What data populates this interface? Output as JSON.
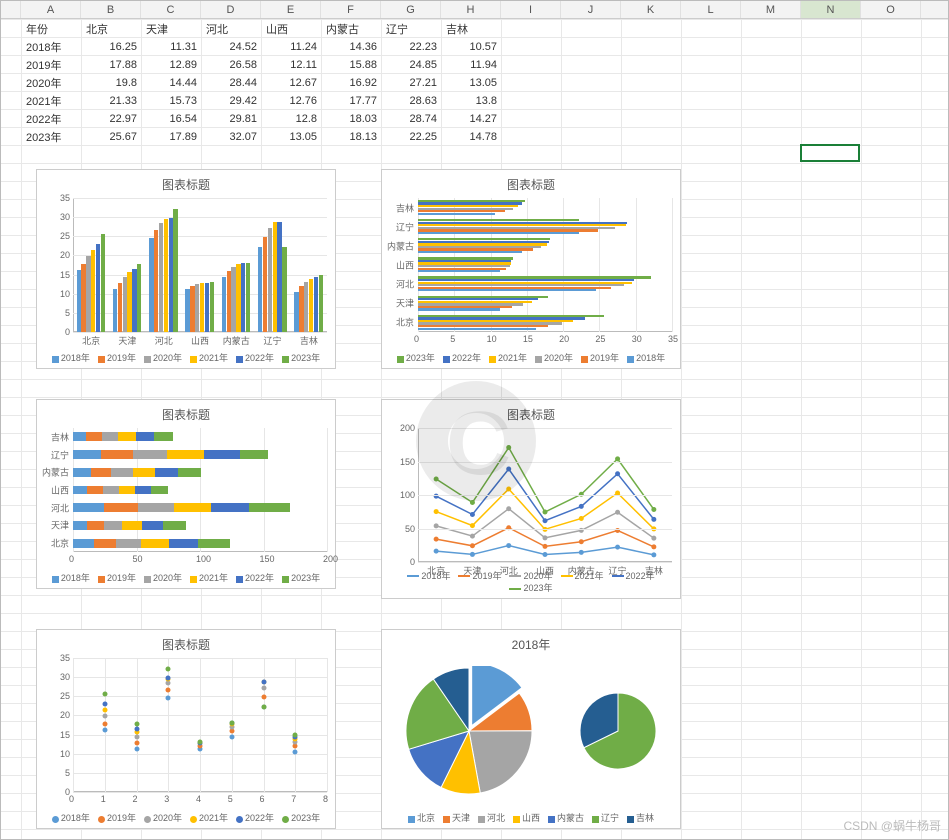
{
  "columns": [
    "",
    "A",
    "B",
    "C",
    "D",
    "E",
    "F",
    "G",
    "H",
    "I",
    "J",
    "K",
    "L",
    "M",
    "N",
    "O"
  ],
  "selected_column": "N",
  "selected_cell": {
    "col_index": 14,
    "row_index": 7
  },
  "table": {
    "headers": [
      "年份",
      "北京",
      "天津",
      "河北",
      "山西",
      "内蒙古",
      "辽宁",
      "吉林"
    ],
    "rows": [
      {
        "year": "2018年",
        "vals": [
          16.25,
          11.31,
          24.52,
          11.24,
          14.36,
          22.23,
          10.57
        ]
      },
      {
        "year": "2019年",
        "vals": [
          17.88,
          12.89,
          26.58,
          12.11,
          15.88,
          24.85,
          11.94
        ]
      },
      {
        "year": "2020年",
        "vals": [
          19.8,
          14.44,
          28.44,
          12.67,
          16.92,
          27.21,
          13.05
        ]
      },
      {
        "year": "2021年",
        "vals": [
          21.33,
          15.73,
          29.42,
          12.76,
          17.77,
          28.63,
          13.8
        ]
      },
      {
        "year": "2022年",
        "vals": [
          22.97,
          16.54,
          29.81,
          12.8,
          18.03,
          28.74,
          14.27
        ]
      },
      {
        "year": "2023年",
        "vals": [
          25.67,
          17.89,
          32.07,
          13.05,
          18.13,
          22.25,
          14.78
        ]
      }
    ]
  },
  "series_colors": {
    "2018年": "#5b9bd5",
    "2019年": "#ed7d31",
    "2020年": "#a5a5a5",
    "2021年": "#ffc000",
    "2022年": "#4472c4",
    "2023年": "#70ad47"
  },
  "region_colors": {
    "北京": "#5b9bd5",
    "天津": "#ed7d31",
    "河北": "#a5a5a5",
    "山西": "#ffc000",
    "内蒙古": "#4472c4",
    "辽宁": "#70ad47",
    "吉林": "#255e91"
  },
  "chart_title_generic": "图表标题",
  "chart_data": [
    {
      "id": "chart1",
      "type": "bar",
      "orientation": "vertical",
      "title": "图表标题",
      "categories": [
        "北京",
        "天津",
        "河北",
        "山西",
        "内蒙古",
        "辽宁",
        "吉林"
      ],
      "series": [
        {
          "name": "2018年",
          "values": [
            16.25,
            11.31,
            24.52,
            11.24,
            14.36,
            22.23,
            10.57
          ]
        },
        {
          "name": "2019年",
          "values": [
            17.88,
            12.89,
            26.58,
            12.11,
            15.88,
            24.85,
            11.94
          ]
        },
        {
          "name": "2020年",
          "values": [
            19.8,
            14.44,
            28.44,
            12.67,
            16.92,
            27.21,
            13.05
          ]
        },
        {
          "name": "2021年",
          "values": [
            21.33,
            15.73,
            29.42,
            12.76,
            17.77,
            28.63,
            13.8
          ]
        },
        {
          "name": "2022年",
          "values": [
            22.97,
            16.54,
            29.81,
            12.8,
            18.03,
            28.74,
            14.27
          ]
        },
        {
          "name": "2023年",
          "values": [
            25.67,
            17.89,
            32.07,
            13.05,
            18.13,
            22.25,
            14.78
          ]
        }
      ],
      "ylim": [
        0,
        35
      ],
      "ystep": 5
    },
    {
      "id": "chart2",
      "type": "bar",
      "orientation": "horizontal",
      "title": "图表标题",
      "categories": [
        "北京",
        "天津",
        "河北",
        "山西",
        "内蒙古",
        "辽宁",
        "吉林"
      ],
      "display_order": [
        "吉林",
        "辽宁",
        "内蒙古",
        "山西",
        "河北",
        "天津",
        "北京"
      ],
      "series": [
        {
          "name": "2023年",
          "values": [
            25.67,
            17.89,
            32.07,
            13.05,
            18.13,
            22.25,
            14.78
          ]
        },
        {
          "name": "2022年",
          "values": [
            22.97,
            16.54,
            29.81,
            12.8,
            18.03,
            28.74,
            14.27
          ]
        },
        {
          "name": "2021年",
          "values": [
            21.33,
            15.73,
            29.42,
            12.76,
            17.77,
            28.63,
            13.8
          ]
        },
        {
          "name": "2020年",
          "values": [
            19.8,
            14.44,
            28.44,
            12.67,
            16.92,
            27.21,
            13.05
          ]
        },
        {
          "name": "2019年",
          "values": [
            17.88,
            12.89,
            26.58,
            12.11,
            15.88,
            24.85,
            11.94
          ]
        },
        {
          "name": "2018年",
          "values": [
            16.25,
            11.31,
            24.52,
            11.24,
            14.36,
            22.23,
            10.57
          ]
        }
      ],
      "xlim": [
        0,
        35
      ],
      "xstep": 5
    },
    {
      "id": "chart3",
      "type": "bar-stacked-horizontal",
      "title": "图表标题",
      "categories": [
        "北京",
        "天津",
        "河北",
        "山西",
        "内蒙古",
        "辽宁",
        "吉林"
      ],
      "display_order": [
        "吉林",
        "辽宁",
        "内蒙古",
        "山西",
        "河北",
        "天津",
        "北京"
      ],
      "series": [
        {
          "name": "2018年",
          "values": [
            16.25,
            11.31,
            24.52,
            11.24,
            14.36,
            22.23,
            10.57
          ]
        },
        {
          "name": "2019年",
          "values": [
            17.88,
            12.89,
            26.58,
            12.11,
            15.88,
            24.85,
            11.94
          ]
        },
        {
          "name": "2020年",
          "values": [
            19.8,
            14.44,
            28.44,
            12.67,
            16.92,
            27.21,
            13.05
          ]
        },
        {
          "name": "2021年",
          "values": [
            21.33,
            15.73,
            29.42,
            12.76,
            17.77,
            28.63,
            13.8
          ]
        },
        {
          "name": "2022年",
          "values": [
            22.97,
            16.54,
            29.81,
            12.8,
            18.03,
            28.74,
            14.27
          ]
        },
        {
          "name": "2023年",
          "values": [
            25.67,
            17.89,
            32.07,
            13.05,
            18.13,
            22.25,
            14.78
          ]
        }
      ],
      "xlim": [
        0,
        200
      ],
      "xstep": 50
    },
    {
      "id": "chart4",
      "type": "line",
      "title": "图表标题",
      "categories": [
        "北京",
        "天津",
        "河北",
        "山西",
        "内蒙古",
        "辽宁",
        "吉林"
      ],
      "series": [
        {
          "name": "2018年",
          "values": [
            16.25,
            11.31,
            24.52,
            11.24,
            14.36,
            22.23,
            10.57
          ]
        },
        {
          "name": "2019年",
          "values": [
            17.88,
            12.89,
            26.58,
            12.11,
            15.88,
            24.85,
            11.94
          ]
        },
        {
          "name": "2020年",
          "values": [
            19.8,
            14.44,
            28.44,
            12.67,
            16.92,
            27.21,
            13.05
          ]
        },
        {
          "name": "2021年",
          "values": [
            21.33,
            15.73,
            29.42,
            12.76,
            17.77,
            28.63,
            13.8
          ]
        },
        {
          "name": "2022年",
          "values": [
            22.97,
            16.54,
            29.81,
            12.8,
            18.03,
            28.74,
            14.27
          ]
        },
        {
          "name": "2023年",
          "values": [
            25.67,
            17.89,
            32.07,
            13.05,
            18.13,
            22.25,
            14.78
          ]
        }
      ],
      "stacked": true,
      "cumulative_ylim": [
        0,
        200
      ],
      "ystep": 50
    },
    {
      "id": "chart5",
      "type": "scatter",
      "title": "图表标题",
      "x": [
        1,
        2,
        3,
        4,
        5,
        6,
        7
      ],
      "x_meaning": [
        "北京",
        "天津",
        "河北",
        "山西",
        "内蒙古",
        "辽宁",
        "吉林"
      ],
      "series": [
        {
          "name": "2018年",
          "values": [
            16.25,
            11.31,
            24.52,
            11.24,
            14.36,
            22.23,
            10.57
          ]
        },
        {
          "name": "2019年",
          "values": [
            17.88,
            12.89,
            26.58,
            12.11,
            15.88,
            24.85,
            11.94
          ]
        },
        {
          "name": "2020年",
          "values": [
            19.8,
            14.44,
            28.44,
            12.67,
            16.92,
            27.21,
            13.05
          ]
        },
        {
          "name": "2021年",
          "values": [
            21.33,
            15.73,
            29.42,
            12.76,
            17.77,
            28.63,
            13.8
          ]
        },
        {
          "name": "2022年",
          "values": [
            22.97,
            16.54,
            29.81,
            12.8,
            18.03,
            28.74,
            14.27
          ]
        },
        {
          "name": "2023年",
          "values": [
            25.67,
            17.89,
            32.07,
            13.05,
            18.13,
            22.25,
            14.78
          ]
        }
      ],
      "xlim": [
        0,
        8
      ],
      "xstep": 1,
      "ylim": [
        0,
        35
      ],
      "ystep": 5
    },
    {
      "id": "chart6",
      "type": "pie",
      "title": "2018年",
      "labels": [
        "北京",
        "天津",
        "河北",
        "山西",
        "内蒙古",
        "辽宁",
        "吉林"
      ],
      "values": [
        16.25,
        11.31,
        24.52,
        11.24,
        14.36,
        22.23,
        10.57
      ],
      "secondary_pie": {
        "labels": [
          "辽宁",
          "吉林"
        ],
        "values": [
          22.23,
          10.57
        ]
      }
    }
  ],
  "watermark": "CSDN @蜗牛杨哥"
}
